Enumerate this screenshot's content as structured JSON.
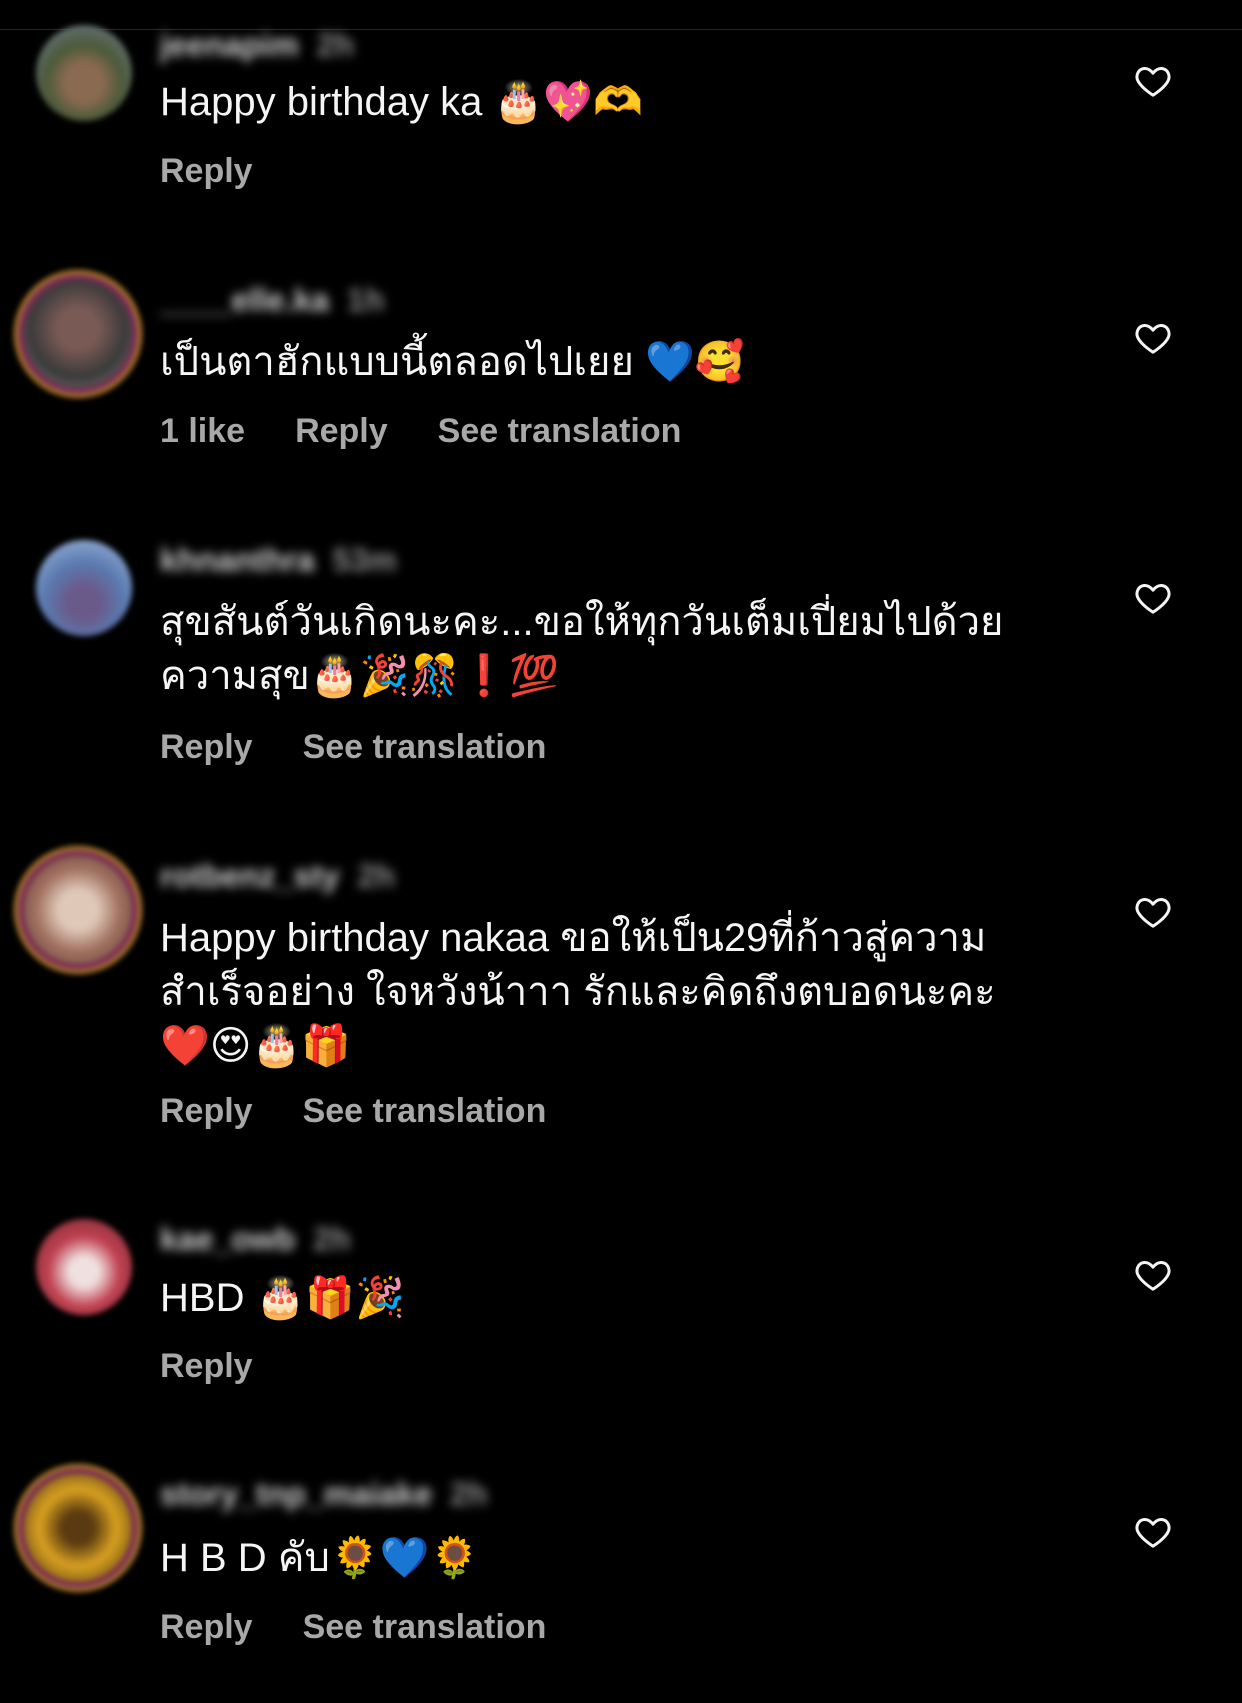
{
  "comments": [
    {
      "username": "jeenapim",
      "time": "2h",
      "text": "Happy birthday ka 🎂💖🫶",
      "likes": "",
      "reply_label": "Reply",
      "translation_label": ""
    },
    {
      "username": "____elle.ka",
      "time": "1h",
      "text": "เป็นตาฮักแบบนี้ตลอดไปเยย 💙🥰",
      "likes": "1 like",
      "reply_label": "Reply",
      "translation_label": "See translation"
    },
    {
      "username": "khnanthra",
      "time": "53m",
      "text": "สุขสันต์วันเกิดนะคะ...ขอให้ทุกวันเต็มเปี่ยมไปด้วยความสุข🎂🎉🎊❗💯",
      "likes": "",
      "reply_label": "Reply",
      "translation_label": "See translation"
    },
    {
      "username": "rotbenz_sty",
      "time": "2h",
      "text": "Happy birthday nakaa ขอให้เป็น29ที่ก้าวสู่ความสำเร็จอย่าง ใจหวังน้าาา รักและคิดถึงตบอดนะคะ❤️😍🎂🎁",
      "likes": "",
      "reply_label": "Reply",
      "translation_label": "See translation"
    },
    {
      "username": "kae_owb",
      "time": "2h",
      "text": "HBD 🎂🎁🎉",
      "likes": "",
      "reply_label": "Reply",
      "translation_label": ""
    },
    {
      "username": "story_tnp_maiake",
      "time": "2h",
      "text": "H B D คับ🌻💙🌻",
      "likes": "",
      "reply_label": "Reply",
      "translation_label": "See translation"
    }
  ],
  "icons": {
    "like": "heart-outline-icon"
  },
  "colors": {
    "background": "#000000",
    "text": "#f5f5f5",
    "secondary": "#a8a8a8"
  }
}
